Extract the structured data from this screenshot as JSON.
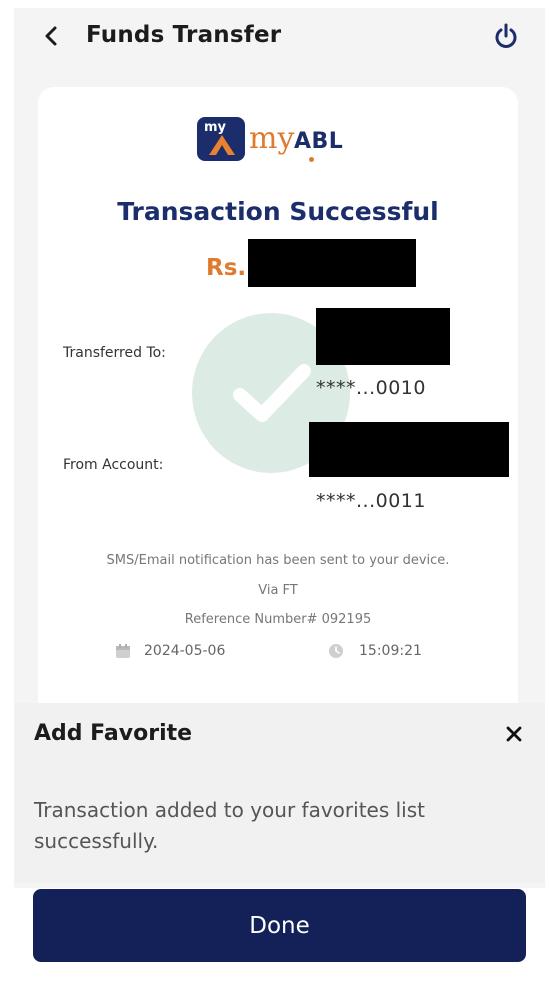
{
  "header": {
    "title": "Funds Transfer",
    "back_icon": "chevron-left-icon",
    "power_icon": "power-icon"
  },
  "receipt": {
    "logo": {
      "my_badge": "my",
      "brand_my": "my",
      "brand_abl": "ABL"
    },
    "status_title": "Transaction Successful",
    "amount_prefix": "Rs.",
    "transferred_to_label": "Transferred To:",
    "transferred_to_account": "****...0010",
    "from_account_label": "From Account:",
    "from_account_number": "****...0011",
    "notification_text": "SMS/Email notification has been sent to your device.",
    "via_text": "Via FT",
    "reference_text": "Reference Number# 092195",
    "date": "2024-05-06",
    "time": "15:09:21"
  },
  "favorite_sheet": {
    "title": "Add Favorite",
    "message": "Transaction added to your favorites list successfully."
  },
  "actions": {
    "done_label": "Done"
  },
  "colors": {
    "brand_navy": "#142159",
    "brand_orange": "#e07a2f",
    "success_mint": "#dcece4"
  }
}
